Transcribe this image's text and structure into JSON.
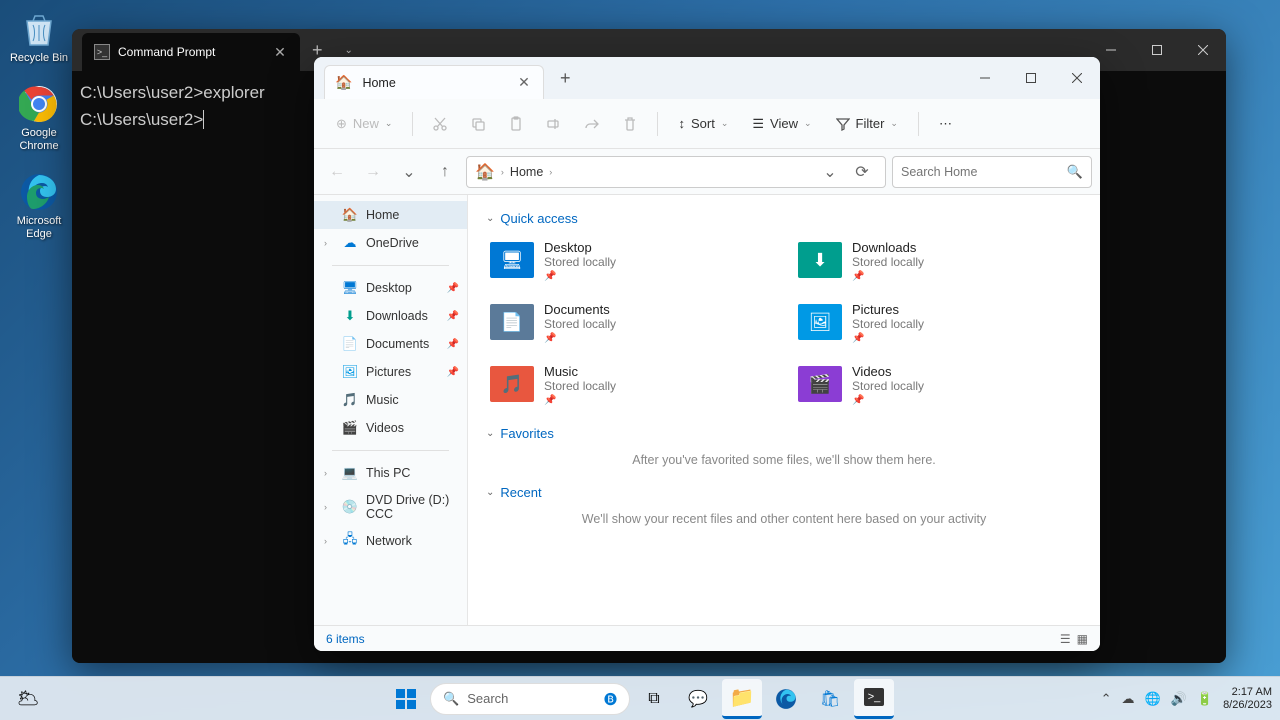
{
  "desktop_icons": {
    "recycle_bin": "Recycle Bin",
    "chrome": "Google Chrome",
    "edge": "Microsoft Edge"
  },
  "cmd": {
    "title": "Command Prompt",
    "line1": "C:\\Users\\user2>explorer",
    "line2": "C:\\Users\\user2>"
  },
  "explorer": {
    "tab_title": "Home",
    "toolbar": {
      "new": "New",
      "sort": "Sort",
      "view": "View",
      "filter": "Filter"
    },
    "breadcrumb": {
      "home": "Home"
    },
    "search_placeholder": "Search Home",
    "sidebar": {
      "home": "Home",
      "onedrive": "OneDrive",
      "desktop": "Desktop",
      "downloads": "Downloads",
      "documents": "Documents",
      "pictures": "Pictures",
      "music": "Music",
      "videos": "Videos",
      "thispc": "This PC",
      "dvd": "DVD Drive (D:) CCC",
      "network": "Network"
    },
    "sections": {
      "quick_access": "Quick access",
      "favorites": "Favorites",
      "recent": "Recent"
    },
    "qa_items": [
      {
        "title": "Desktop",
        "sub": "Stored locally",
        "color": "#0078d4"
      },
      {
        "title": "Downloads",
        "sub": "Stored locally",
        "color": "#009e8e"
      },
      {
        "title": "Documents",
        "sub": "Stored locally",
        "color": "#5b7a99"
      },
      {
        "title": "Pictures",
        "sub": "Stored locally",
        "color": "#0099e5"
      },
      {
        "title": "Music",
        "sub": "Stored locally",
        "color": "#e8573f"
      },
      {
        "title": "Videos",
        "sub": "Stored locally",
        "color": "#8b3dd4"
      }
    ],
    "favorites_empty": "After you've favorited some files, we'll show them here.",
    "recent_empty": "We'll show your recent files and other content here based on your activity",
    "status": "6 items"
  },
  "taskbar": {
    "search_placeholder": "Search",
    "time": "2:17 AM",
    "date": "8/26/2023"
  }
}
